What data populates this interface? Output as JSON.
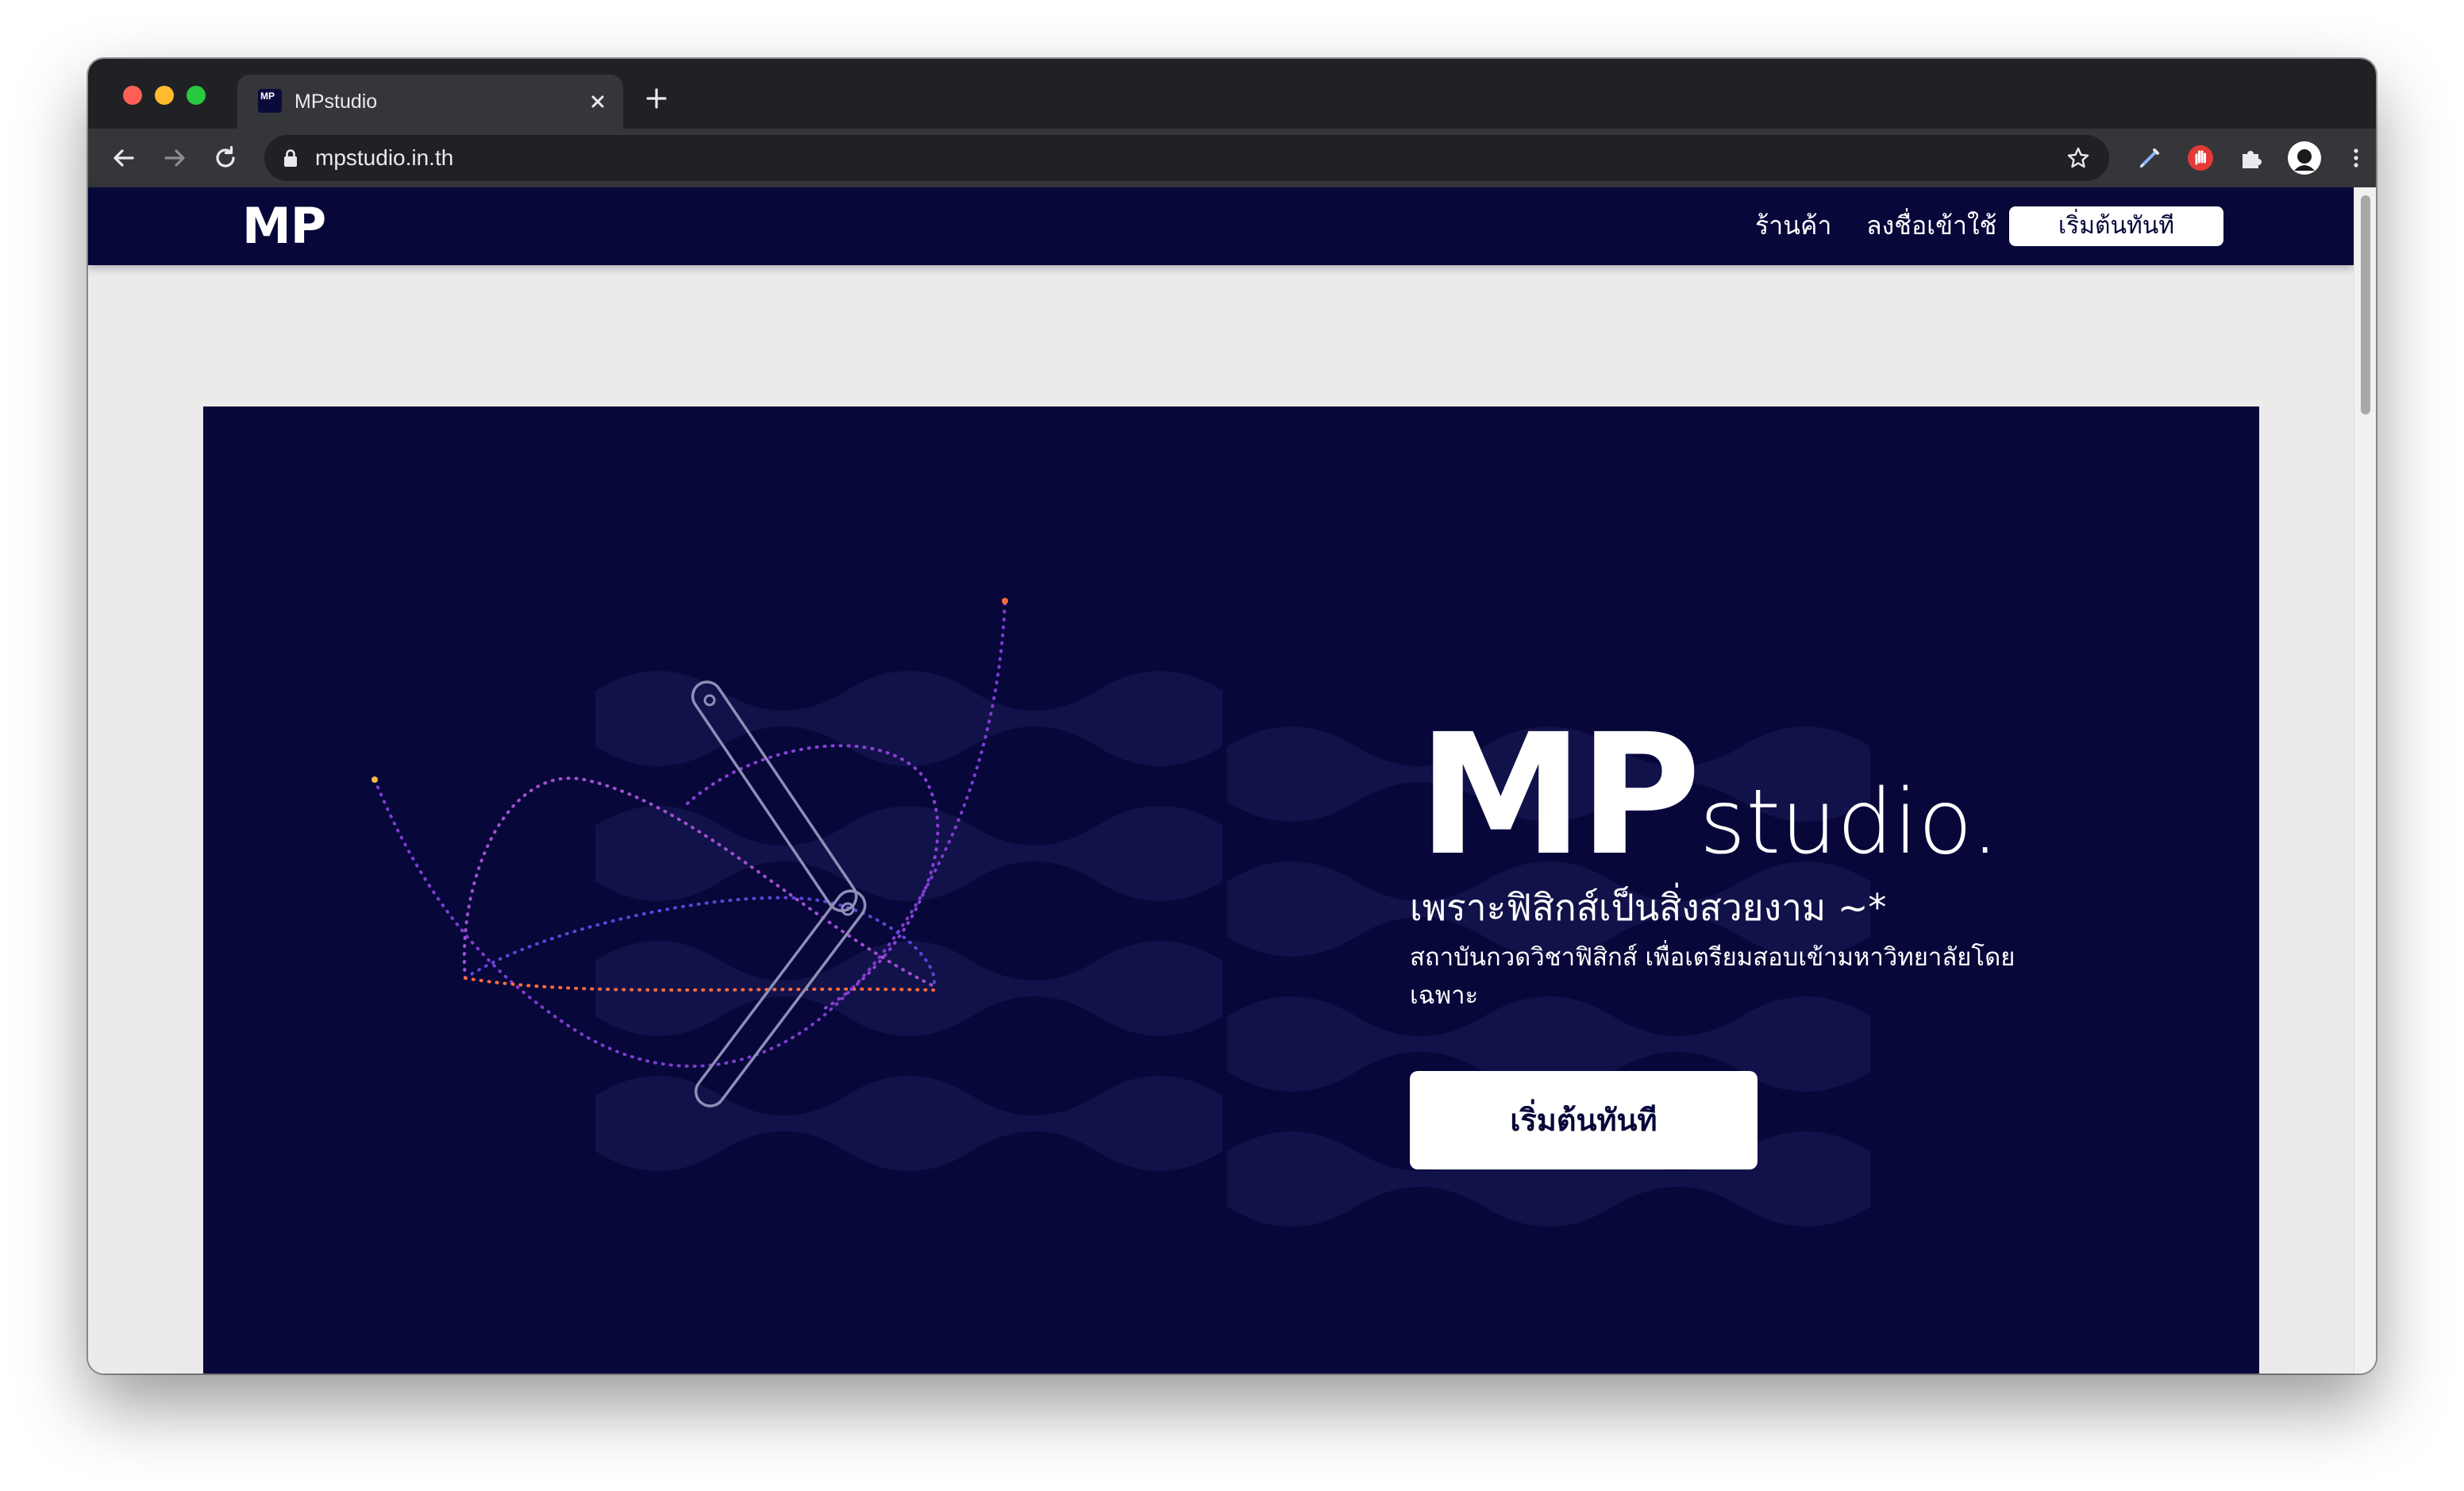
{
  "browser": {
    "tab": {
      "favicon_text": "MP",
      "title": "MPstudio"
    },
    "address_bar": {
      "url": "mpstudio.in.th"
    },
    "icons": [
      "back-arrow-icon",
      "forward-arrow-icon",
      "reload-icon",
      "lock-icon",
      "star-icon",
      "pen-extension-icon",
      "block-extension-icon",
      "puzzle-extension-icon",
      "profile-avatar-icon",
      "kebab-menu-icon"
    ]
  },
  "site_nav": {
    "logo": "MP",
    "links": [
      "ร้านค้า",
      "ลงชื่อเข้าใช้"
    ],
    "cta": "เริ่มต้นทันที",
    "bg_color": "#07073a"
  },
  "hero": {
    "brand_main": "MP",
    "brand_suffix": "studio.",
    "tagline": "เพราะฟิสิกส์เป็นสิ่งสวยงาม ~*",
    "description": "สถาบันกวดวิชาฟิสิกส์ เพื่อเตรียมสอบเข้ามหาวิทยาลัยโดยเฉพาะ",
    "cta": "เริ่มต้นทันที",
    "bg_color": "#07073a",
    "accent_colors": [
      "#ff6a3d",
      "#8a3fd6",
      "#2d2d82"
    ]
  }
}
